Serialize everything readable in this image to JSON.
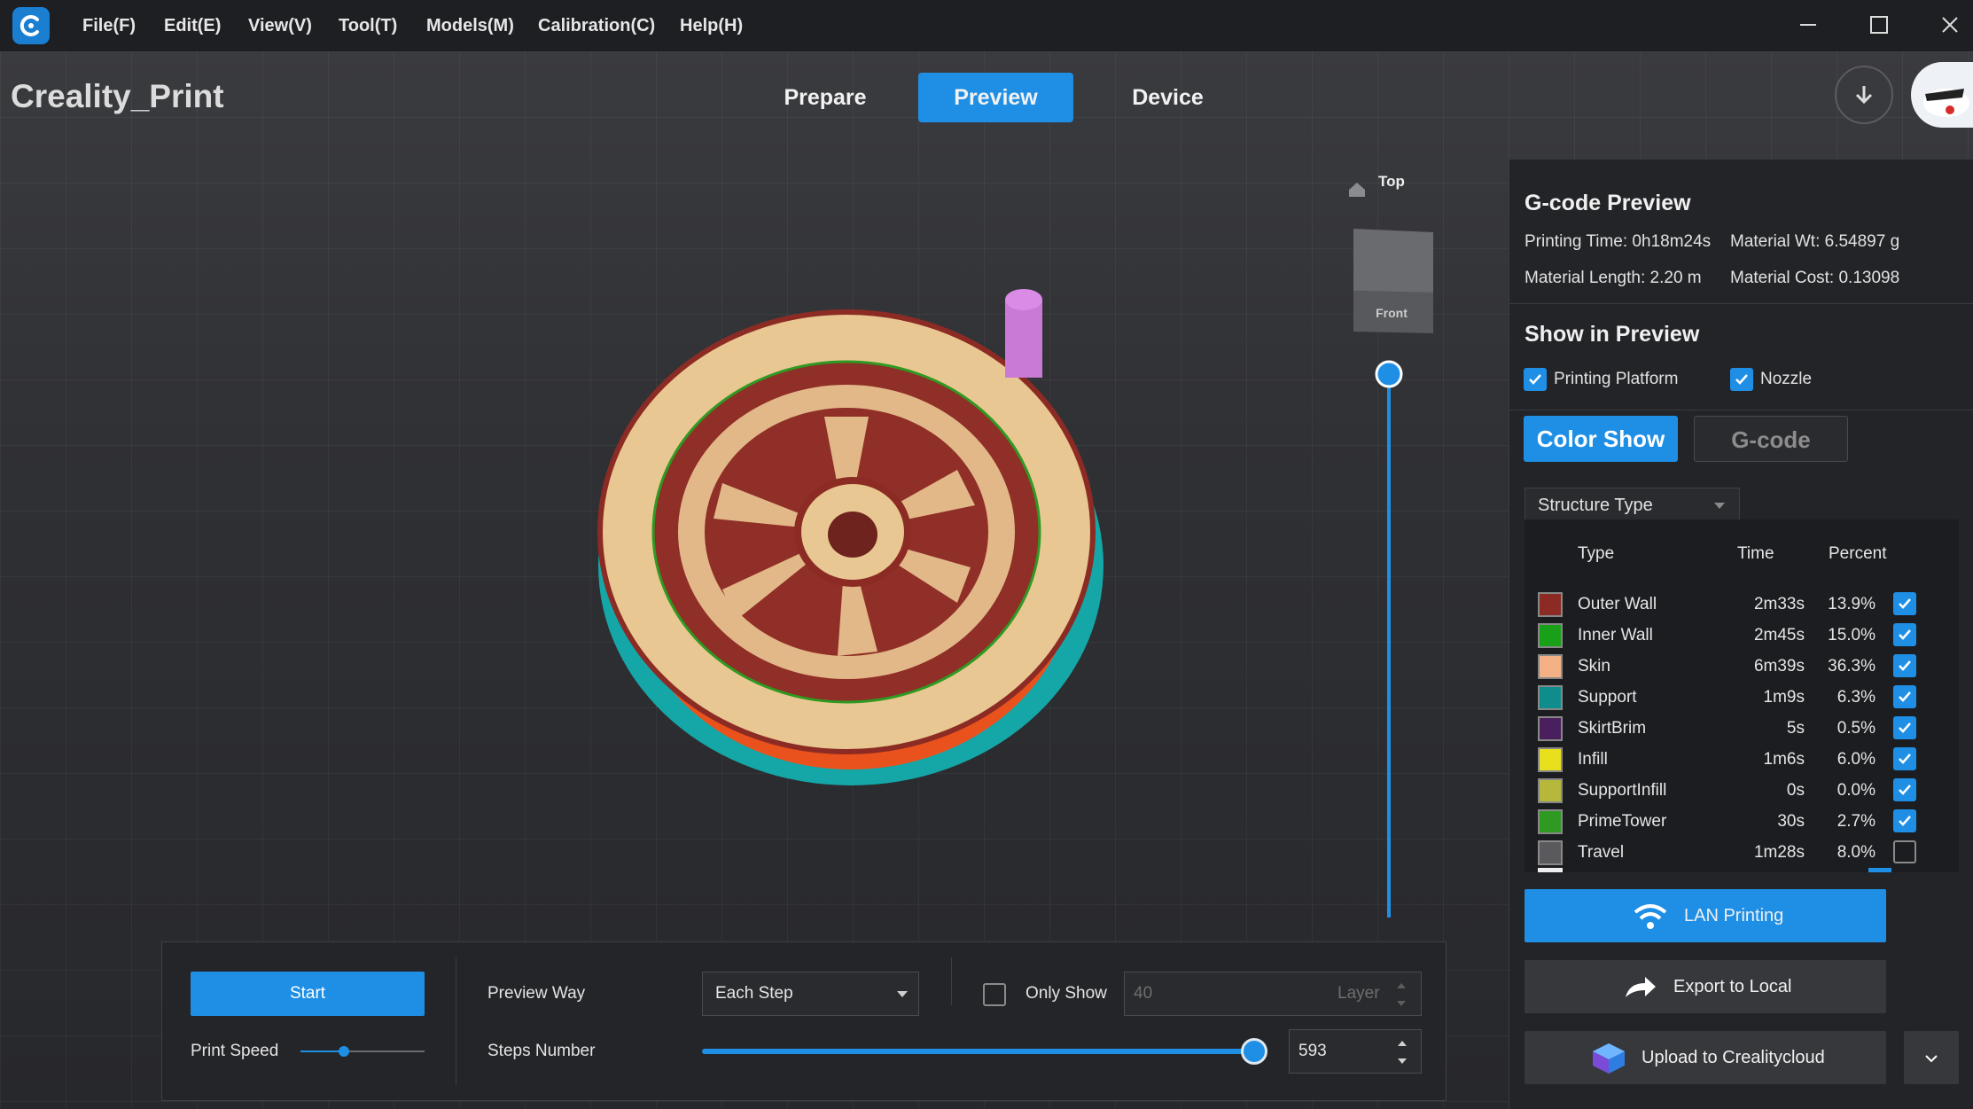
{
  "menu": {
    "items": [
      "File(F)",
      "Edit(E)",
      "View(V)",
      "Tool(T)",
      "Models(M)",
      "Calibration(C)",
      "Help(H)"
    ]
  },
  "window": {
    "title": "Creality_Print"
  },
  "tabs": {
    "prepare": "Prepare",
    "preview": "Preview",
    "device": "Device"
  },
  "view_cube": {
    "top": "Top",
    "front": "Front"
  },
  "gcode_preview": {
    "title": "G-code Preview",
    "printing_time": "Printing Time: 0h18m24s",
    "material_wt": "Material Wt: 6.54897 g",
    "material_length": "Material Length: 2.20 m",
    "material_cost": "Material Cost: 0.13098"
  },
  "show_in_preview": {
    "title": "Show in Preview",
    "printing_platform": "Printing Platform",
    "nozzle": "Nozzle",
    "color_show": "Color Show",
    "gcode": "G-code"
  },
  "structure": {
    "dropdown": "Structure Type",
    "headers": {
      "type": "Type",
      "time": "Time",
      "percent": "Percent"
    },
    "rows": [
      {
        "type": "Outer Wall",
        "time": "2m33s",
        "percent": "13.9%",
        "color": "#8b2b24",
        "checked": true
      },
      {
        "type": "Inner Wall",
        "time": "2m45s",
        "percent": "15.0%",
        "color": "#18a018",
        "checked": true
      },
      {
        "type": "Skin",
        "time": "6m39s",
        "percent": "36.3%",
        "color": "#f5b186",
        "checked": true
      },
      {
        "type": "Support",
        "time": "1m9s",
        "percent": "6.3%",
        "color": "#0f8c8c",
        "checked": true
      },
      {
        "type": "SkirtBrim",
        "time": "5s",
        "percent": "0.5%",
        "color": "#4a1f5e",
        "checked": true
      },
      {
        "type": "Infill",
        "time": "1m6s",
        "percent": "6.0%",
        "color": "#e8e01c",
        "checked": true
      },
      {
        "type": "SupportInfill",
        "time": "0s",
        "percent": "0.0%",
        "color": "#b5b83a",
        "checked": true
      },
      {
        "type": "PrimeTower",
        "time": "30s",
        "percent": "2.7%",
        "color": "#2e9a22",
        "checked": true
      },
      {
        "type": "Travel",
        "time": "1m28s",
        "percent": "8.0%",
        "color": "#5a5a5e",
        "checked": false
      }
    ]
  },
  "actions": {
    "lan_printing": "LAN Printing",
    "export_local": "Export to Local",
    "upload_cloud": "Upload to Crealitycloud"
  },
  "bottom": {
    "start": "Start",
    "print_speed": "Print Speed",
    "print_speed_fraction": 0.35,
    "preview_way": "Preview Way",
    "preview_way_value": "Each Step",
    "only_show": "Only Show",
    "layer_value": "40",
    "layer_unit": "Layer",
    "steps_number": "Steps Number",
    "steps_value": "593",
    "steps_fraction": 1.0
  },
  "colors": {
    "accent": "#1f8fe6"
  }
}
